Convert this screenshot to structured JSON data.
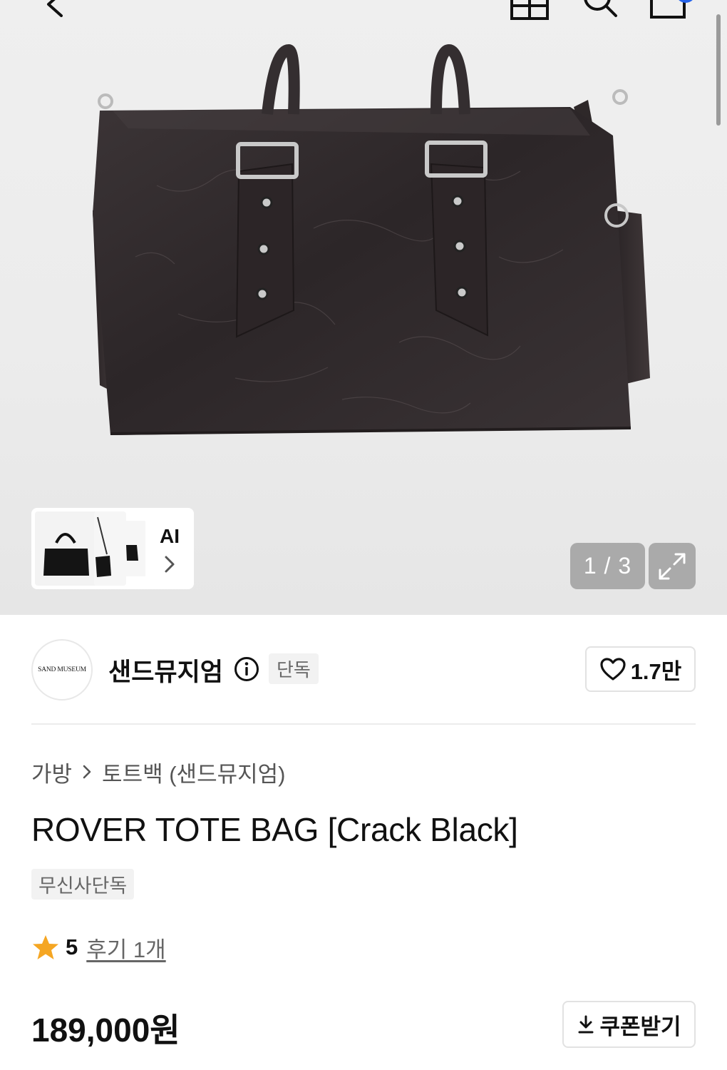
{
  "gallery": {
    "counter": "1 / 3",
    "ai_label": "AI",
    "thumbnail_count": 3,
    "product_image": "black crackle leather tote bag with buckle straps"
  },
  "brand": {
    "logo_text": "SAND MUSEUM",
    "name": "샌드뮤지엄",
    "exclusive_tag": "단독",
    "like_count": "1.7만"
  },
  "breadcrumb": {
    "category": "가방",
    "subcategory": "토트백 (샌드뮤지엄)"
  },
  "product": {
    "title": "ROVER TOTE BAG [Crack Black]",
    "badge": "무신사단독",
    "rating": "5",
    "reviews": "후기 1개",
    "price": "189,000원"
  },
  "coupon": {
    "label": "쿠폰받기"
  },
  "icons": {
    "back": "back-arrow-icon",
    "home": "home-icon",
    "search": "search-icon",
    "cart": "cart-icon",
    "info": "info-icon",
    "heart": "heart-icon",
    "star": "star-icon",
    "download": "download-icon",
    "expand": "expand-icon"
  },
  "colors": {
    "star": "#F5A623",
    "badge_blue": "#2563EB",
    "tag_bg": "#F2F2F2"
  }
}
